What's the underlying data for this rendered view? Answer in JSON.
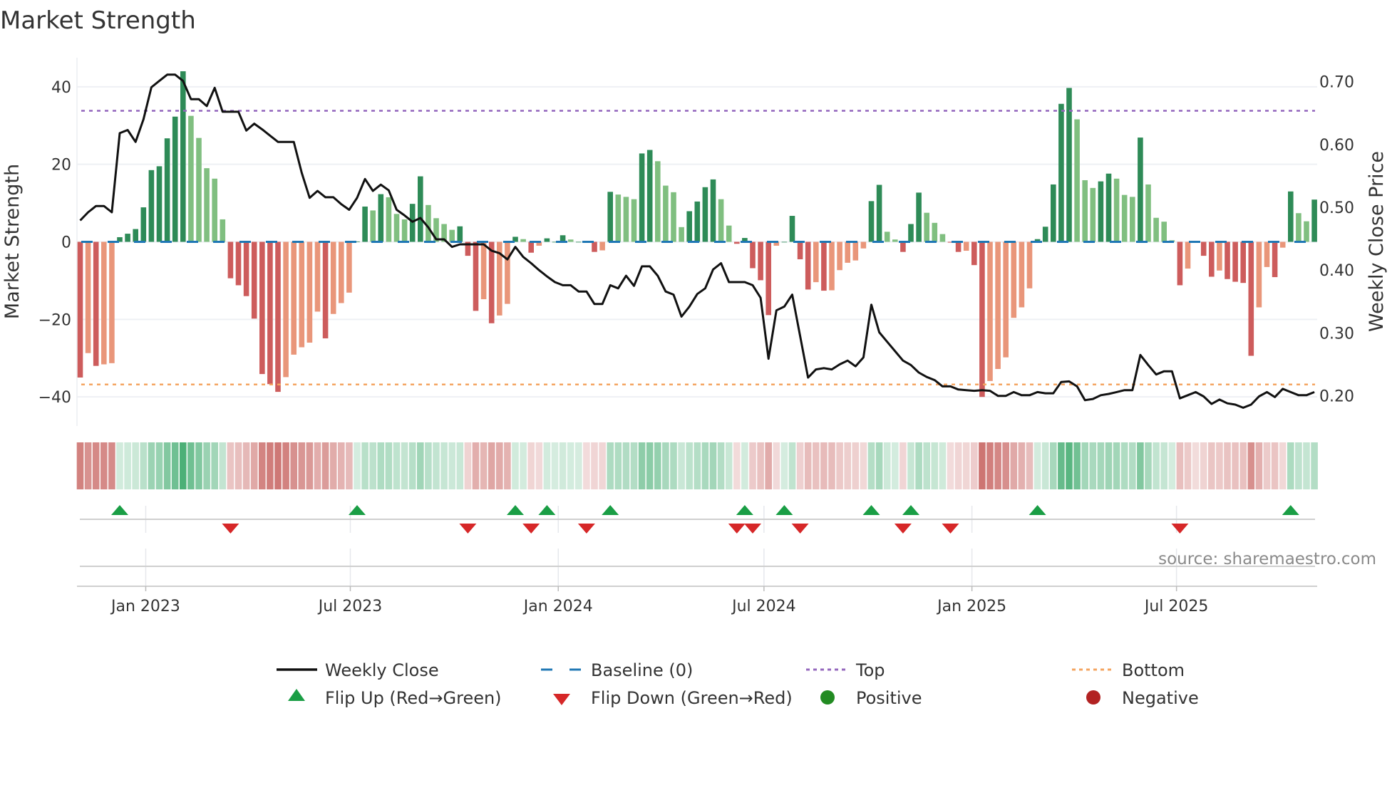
{
  "chart_data": {
    "type": "bar",
    "title": "Market Strength",
    "ylabel": "Market Strength",
    "y2label": "Weekly Close Price",
    "ylim": [
      -47.5,
      47.5
    ],
    "y2lim": [
      0.152,
      0.738
    ],
    "yticks": [
      {
        "v": 40,
        "label": "40"
      },
      {
        "v": 20,
        "label": "20"
      },
      {
        "v": 0,
        "label": "0"
      },
      {
        "v": -20,
        "label": "−20"
      },
      {
        "v": -40,
        "label": "−40"
      }
    ],
    "y2ticks": [
      {
        "v": 0.7,
        "label": "0.70"
      },
      {
        "v": 0.6,
        "label": "0.60"
      },
      {
        "v": 0.5,
        "label": "0.50"
      },
      {
        "v": 0.4,
        "label": "0.40"
      },
      {
        "v": 0.3,
        "label": "0.30"
      },
      {
        "v": 0.2,
        "label": "0.20"
      }
    ],
    "xticks": [
      {
        "date": "2023-01-01",
        "label": "Jan 2023"
      },
      {
        "date": "2023-07-01",
        "label": "Jul 2023"
      },
      {
        "date": "2024-01-01",
        "label": "Jan 2024"
      },
      {
        "date": "2024-07-01",
        "label": "Jul 2024"
      },
      {
        "date": "2025-01-01",
        "label": "Jan 2025"
      },
      {
        "date": "2025-07-01",
        "label": "Jul 2025"
      }
    ],
    "first_week": "2022-11-04",
    "top_level": 33.8,
    "bottom_level": -36.8,
    "strength": [
      -35,
      -28.7,
      -32,
      -31.6,
      -31.3,
      1.2,
      2.1,
      3.3,
      8.9,
      18.5,
      19.5,
      26.7,
      32.3,
      44,
      32.5,
      26.8,
      19,
      16.3,
      5.8,
      -9.4,
      -11.2,
      -14,
      -19.8,
      -34.1,
      -36.7,
      -38.7,
      -34.9,
      -29.1,
      -27.2,
      -26,
      -18,
      -24.9,
      -18.6,
      -15.8,
      -13.1,
      0.1,
      9.1,
      8.1,
      12.3,
      11.5,
      7.2,
      5.8,
      9.8,
      16.9,
      9.5,
      6.1,
      4.6,
      3.1,
      4,
      -3.6,
      -17.8,
      -14.8,
      -21,
      -19,
      -16,
      1.3,
      0.7,
      -2.8,
      -1,
      0.9,
      0,
      1.7,
      0.6,
      0,
      -0.2,
      -2.6,
      -2.2,
      12.9,
      12.2,
      11.6,
      11,
      22.8,
      23.7,
      20.8,
      14.5,
      12.8,
      3.8,
      7.9,
      10.4,
      14.1,
      16.1,
      11,
      4.2,
      -0.5,
      1,
      -6.8,
      -9.9,
      -18.9,
      -1,
      0,
      6.7,
      -4.5,
      -12.3,
      -10.4,
      -12.6,
      -12.5,
      -7.3,
      -5.4,
      -4.8,
      -1.7,
      10.5,
      14.7,
      2.6,
      0.6,
      -2.6,
      4.6,
      12.7,
      7.5,
      4.9,
      2,
      -0.2,
      -2.6,
      -2.3,
      -6,
      -40,
      -35.9,
      -32.8,
      -29.8,
      -19.6,
      -16.9,
      -12,
      0.7,
      3.9,
      14.8,
      35.6,
      39.7,
      31.6,
      15.9,
      13.9,
      15.6,
      17.6,
      16.3,
      12.1,
      11.6,
      26.9,
      14.8,
      6.2,
      5.2,
      0.4,
      -11.2,
      -6.9,
      -0.1,
      -3.6,
      -9,
      -7.4,
      -9.6,
      -10.3,
      -10.6,
      -29.4,
      -16.9,
      -6.5,
      -9.1,
      -1.5,
      13,
      7.4,
      5.3,
      10.9
    ],
    "weekly_close": [
      0.479,
      0.492,
      0.502,
      0.502,
      0.492,
      0.618,
      0.623,
      0.604,
      0.64,
      0.691,
      0.701,
      0.711,
      0.711,
      0.701,
      0.672,
      0.672,
      0.661,
      0.69,
      0.652,
      0.652,
      0.652,
      0.622,
      0.633,
      0.624,
      0.614,
      0.604,
      0.604,
      0.604,
      0.555,
      0.515,
      0.526,
      0.516,
      0.516,
      0.505,
      0.496,
      0.515,
      0.545,
      0.526,
      0.536,
      0.527,
      0.496,
      0.487,
      0.477,
      0.483,
      0.468,
      0.449,
      0.449,
      0.437,
      0.441,
      0.441,
      0.441,
      0.441,
      0.431,
      0.427,
      0.417,
      0.437,
      0.421,
      0.411,
      0.4,
      0.39,
      0.381,
      0.376,
      0.376,
      0.366,
      0.366,
      0.346,
      0.346,
      0.376,
      0.371,
      0.391,
      0.375,
      0.406,
      0.406,
      0.391,
      0.366,
      0.361,
      0.326,
      0.342,
      0.362,
      0.371,
      0.401,
      0.411,
      0.381,
      0.381,
      0.381,
      0.376,
      0.356,
      0.259,
      0.336,
      0.342,
      0.361,
      0.295,
      0.229,
      0.242,
      0.244,
      0.242,
      0.25,
      0.256,
      0.247,
      0.261,
      0.345,
      0.301,
      0.286,
      0.271,
      0.256,
      0.249,
      0.237,
      0.23,
      0.225,
      0.215,
      0.215,
      0.21,
      0.209,
      0.208,
      0.209,
      0.208,
      0.2,
      0.2,
      0.206,
      0.201,
      0.201,
      0.206,
      0.204,
      0.204,
      0.222,
      0.223,
      0.215,
      0.193,
      0.195,
      0.201,
      0.203,
      0.206,
      0.209,
      0.209,
      0.265,
      0.249,
      0.234,
      0.239,
      0.239,
      0.196,
      0.201,
      0.206,
      0.199,
      0.187,
      0.194,
      0.188,
      0.186,
      0.181,
      0.186,
      0.199,
      0.206,
      0.198,
      0.211,
      0.206,
      0.201,
      0.201,
      0.206
    ],
    "flip_up_weeks": [
      5,
      35,
      55,
      59,
      67,
      84,
      89,
      100,
      105,
      121,
      153
    ],
    "flip_down_weeks": [
      19,
      49,
      57,
      64,
      83,
      85,
      91,
      104,
      110,
      139
    ],
    "legend": {
      "weekly_close": "Weekly Close",
      "baseline": "Baseline (0)",
      "top": "Top",
      "bottom": "Bottom",
      "flip_up": "Flip Up (Red→Green)",
      "flip_down": "Flip Down (Green→Red)",
      "positive": "Positive",
      "negative": "Negative"
    },
    "legend_placement": "bottom-center",
    "colors": {
      "pos_strong": "#2e8b57",
      "pos_weak": "#80bf80",
      "neg_strong": "#cd5c5c",
      "neg_weak": "#e9967a",
      "close": "#111111",
      "baseline": "#1f77b4",
      "top": "#9467bd",
      "bottom": "#f4a460",
      "flip_up": "#1a9e45",
      "flip_down": "#d62728",
      "positive": "#228b22",
      "negative": "#b22222",
      "heat_pos": "#2ca25f",
      "heat_neg": "#c0504d"
    },
    "source": "source: sharemaestro.com"
  }
}
